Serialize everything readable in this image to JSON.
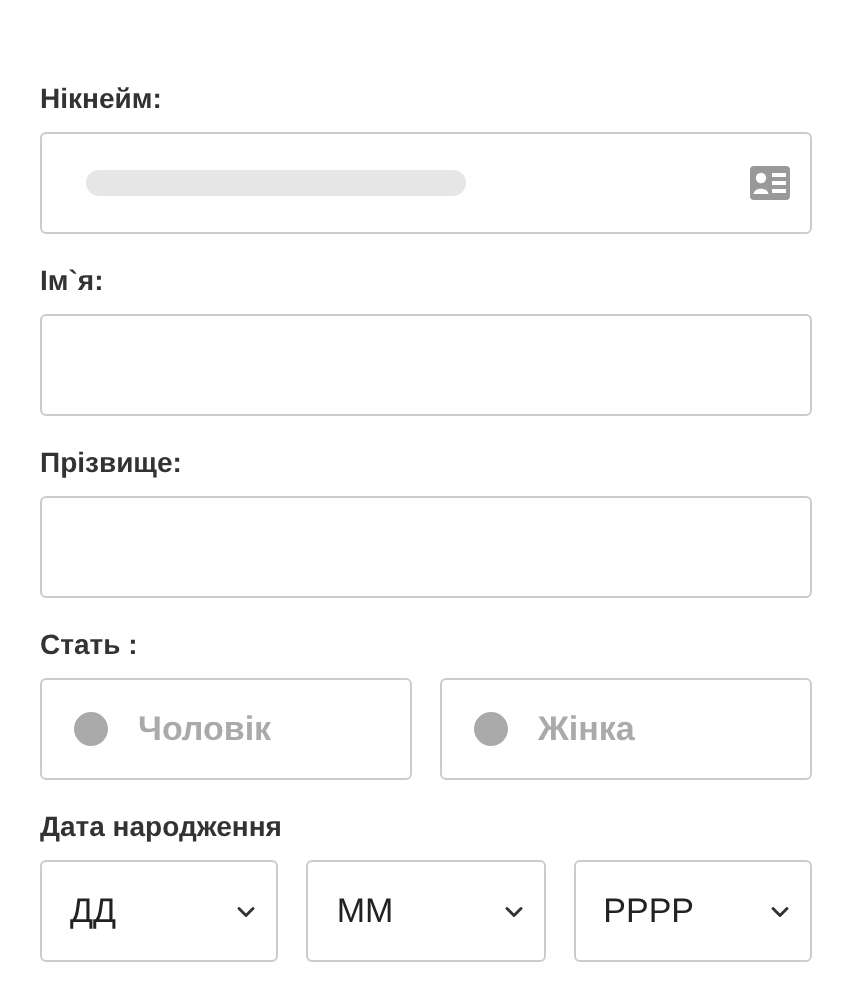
{
  "nickname": {
    "label": "Нікнейм:",
    "value_redacted": true
  },
  "first_name": {
    "label": "Ім`я:"
  },
  "last_name": {
    "label": "Прізвище:"
  },
  "gender": {
    "label": "Стать :",
    "options": [
      {
        "label": "Чоловік",
        "selected": false
      },
      {
        "label": "Жінка",
        "selected": false
      }
    ]
  },
  "birth_date": {
    "label": "Дата народження",
    "selects": [
      {
        "value": "ДД"
      },
      {
        "value": "ММ"
      },
      {
        "value": "РРРР"
      }
    ]
  }
}
